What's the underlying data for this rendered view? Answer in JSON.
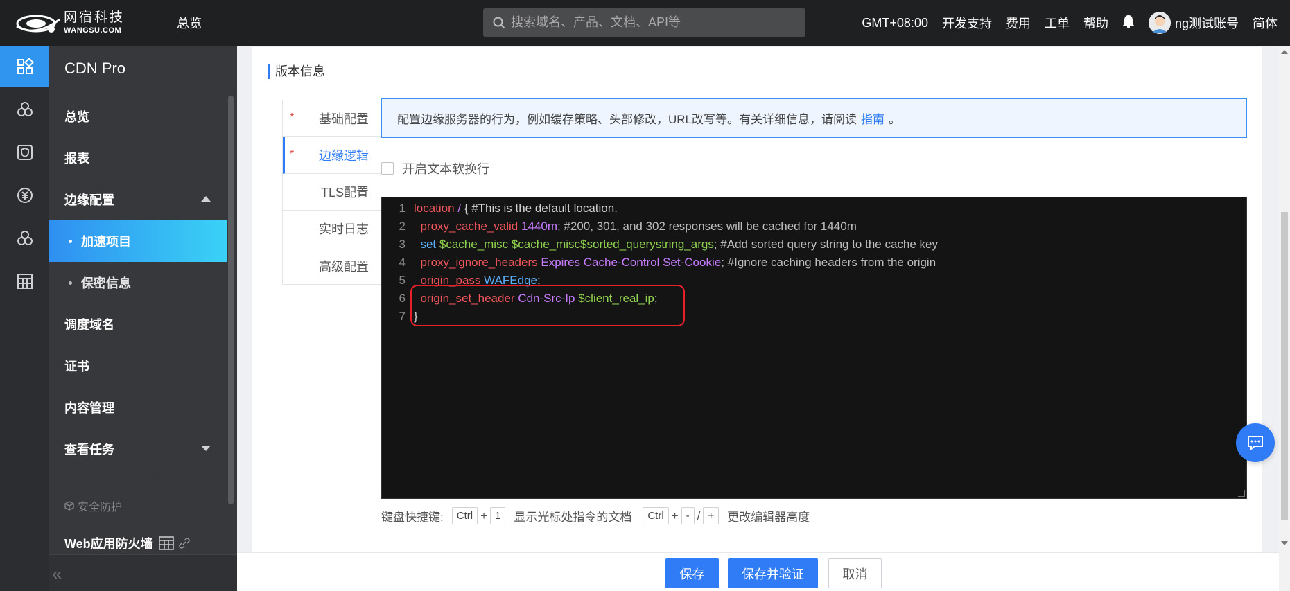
{
  "topbar": {
    "logo_cn": "网宿科技",
    "logo_en": "WANGSU.COM",
    "overview": "总览",
    "search_placeholder": "搜索域名、产品、文档、API等",
    "timezone": "GMT+08:00",
    "dev_support": "开发支持",
    "fees": "费用",
    "tickets": "工单",
    "help": "帮助",
    "username": "ng测试账号",
    "language": "简体"
  },
  "rail": {
    "items": [
      "dashboard-icon",
      "cluster-icon",
      "shield-icon",
      "money-icon",
      "cluster-icon",
      "table-icon"
    ]
  },
  "sidebar": {
    "title": "CDN Pro",
    "items": {
      "overview": "总览",
      "reports": "报表",
      "edge_config": "边缘配置",
      "accel_projects": "加速项目",
      "secrets": "保密信息",
      "dispatch_domains": "调度域名",
      "certs": "证书",
      "content_mgmt": "内容管理",
      "view_tasks": "查看任务"
    },
    "section_security": "安全防护",
    "waf": "Web应用防火墙"
  },
  "main": {
    "section_title": "版本信息",
    "tabs": {
      "basic": "基础配置",
      "edge_logic": "边缘逻辑",
      "tls": "TLS配置",
      "realtime_log": "实时日志",
      "advanced": "高级配置"
    },
    "required_mark": "*",
    "info_text": "配置边缘服务器的行为，例如缓存策略、头部修改，URL改写等。有关详细信息，请阅读",
    "info_link": "指南",
    "info_end": "。",
    "soft_wrap_label": "开启文本软换行",
    "editor": {
      "line_numbers": [
        "1",
        "2",
        "3",
        "4",
        "5",
        "6",
        "7"
      ],
      "l1_kw": "location",
      "l1_val": "/",
      "l1_rest": " { #This is the default location.",
      "l2_kw": "proxy_cache_valid",
      "l2_val": "1440m",
      "l2_rest": "; #200, 301, and 302 responses will be cached for 1440m",
      "l3_kw": "set",
      "l3_var": "$cache_misc",
      "l3_var2": "$cache_misc$sorted_querystring_args",
      "l3_rest": "; #Add sorted query string to the cache key",
      "l4_kw": "proxy_ignore_headers",
      "l4_val": "Expires Cache-Control Set-Cookie",
      "l4_rest": "; #Ignore caching headers from the origin",
      "l5_kw": "origin_pass",
      "l5_val": "WAFEdge",
      "l5_rest": ";",
      "l6_kw": "origin_set_header",
      "l6_val": "Cdn-Src-Ip",
      "l6_var": "$client_real_ip",
      "l6_rest": ";",
      "l7": "}"
    },
    "shortcuts": {
      "label": "键盘快捷键:",
      "ctrl": "Ctrl",
      "plus": "+",
      "one": "1",
      "show_doc": "显示光标处指令的文档",
      "minus": "-",
      "slash": "/",
      "plus_key": "+",
      "change_height": "更改编辑器高度"
    }
  },
  "buttons": {
    "save": "保存",
    "save_verify": "保存并验证",
    "cancel": "取消"
  },
  "colors": {
    "accent": "#2f7cf6",
    "topbar_bg": "#1f2022",
    "sidebar_bg": "#36383b",
    "highlight_border": "#e8202a"
  }
}
